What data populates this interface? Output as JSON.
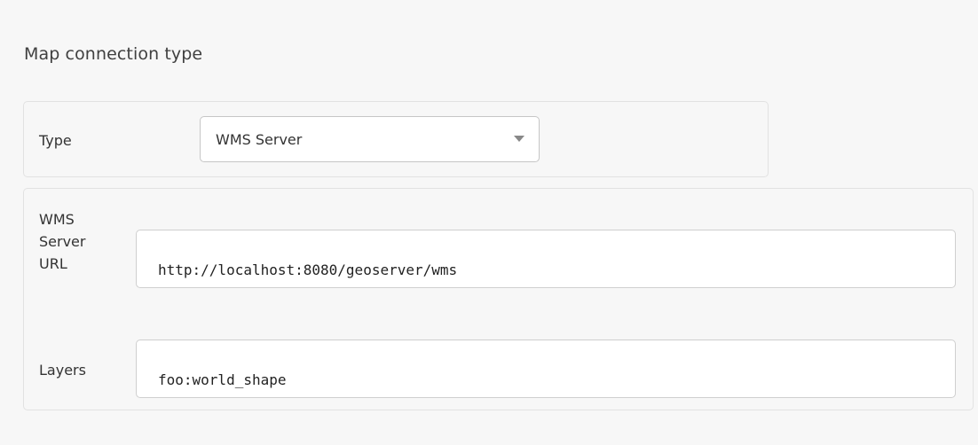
{
  "section": {
    "title": "Map connection type"
  },
  "type_field": {
    "label": "Type",
    "selected": "WMS Server",
    "caret_icon": "caret-down-icon"
  },
  "wms_server": {
    "url_label_line1": "WMS",
    "url_label_line2": "Server",
    "url_label_line3": "URL",
    "url_value": "http://localhost:8080/geoserver/wms",
    "layers_label": "Layers",
    "layers_value": "foo:world_shape"
  }
}
